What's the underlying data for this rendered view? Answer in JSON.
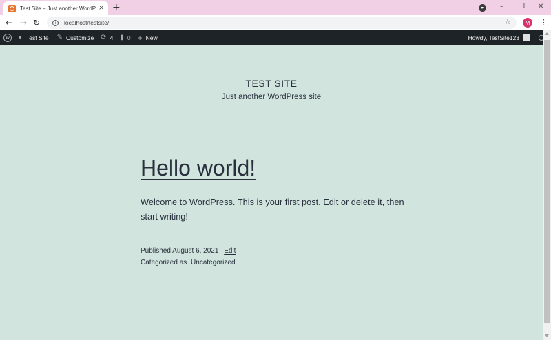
{
  "browser": {
    "tab_title": "Test Site – Just another WordPress site",
    "tab_close": "×",
    "new_tab": "+",
    "url": "localhost/testsite/",
    "profile_initial": "M",
    "window_minimize": "–",
    "window_restore": "❐",
    "window_close": "✕"
  },
  "adminbar": {
    "site_name": "Test Site",
    "customize": "Customize",
    "updates_count": "4",
    "comments_count": "0",
    "new_label": "New",
    "greeting": "Howdy, TestSite123"
  },
  "site": {
    "title": "TEST SITE",
    "description": "Just another WordPress site"
  },
  "post": {
    "title": "Hello world!",
    "body": "Welcome to WordPress. This is your first post. Edit or delete it, then start writing!",
    "published_prefix": "Published",
    "published_date": "August 6, 2021",
    "edit_link": "Edit",
    "categorized_prefix": "Categorized as",
    "category": "Uncategorized"
  },
  "colors": {
    "page_background": "#d1e4dd",
    "admin_bar": "#1d2327",
    "tab_strip": "#f1cfe4",
    "text": "#28303d"
  }
}
